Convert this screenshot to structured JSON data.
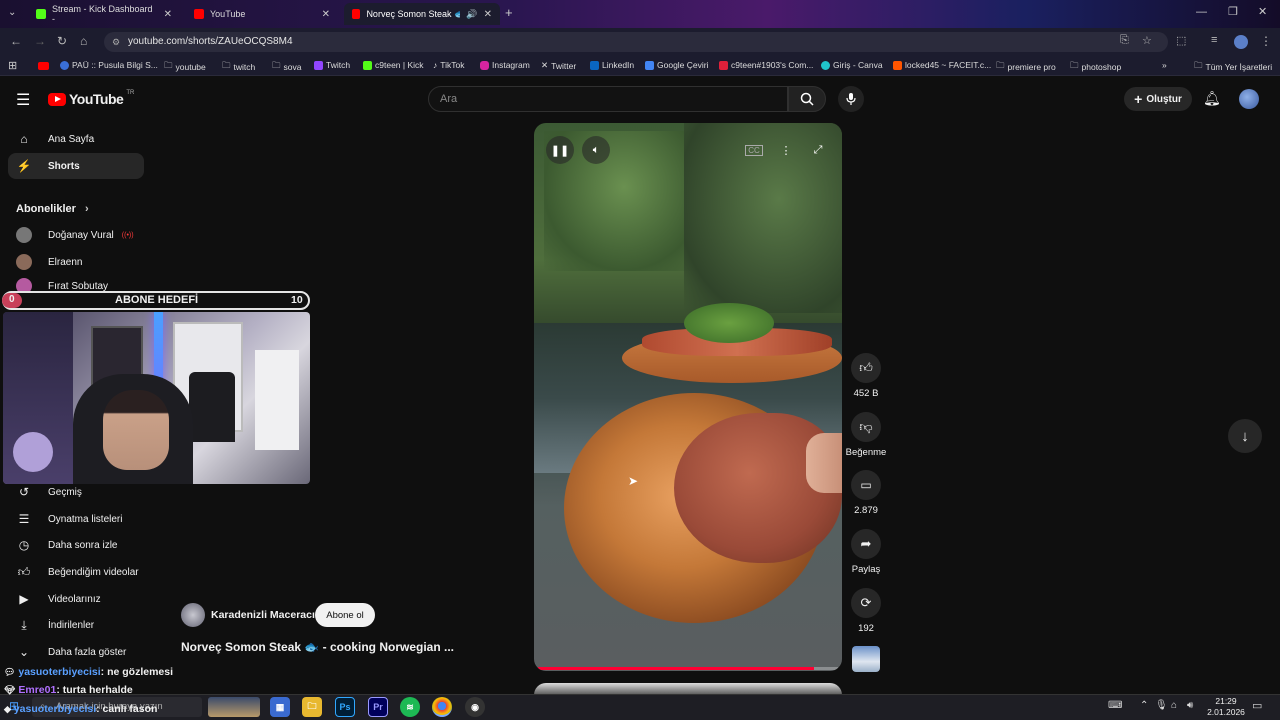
{
  "browser": {
    "tabs": [
      {
        "title": "Stream - Kick Dashboard -",
        "favicon_color": "#53fc18"
      },
      {
        "title": "YouTube",
        "favicon_color": "#ff0000"
      },
      {
        "title": "Norveç Somon Steak 🐟 - c",
        "favicon_color": "#ff0000"
      }
    ],
    "url": "youtube.com/shorts/ZAUeOCQS8M4",
    "bookmarks": [
      "PAÜ :: Pusula Bilgi S...",
      "youtube",
      "twitch",
      "sova",
      "Twitch",
      "c9teen | Kick",
      "TikTok",
      "Instagram",
      "Twitter",
      "LinkedIn",
      "Google Çeviri",
      "c9teen#1903's Com...",
      "Giriş - Canva",
      "locked45 ~ FACEIT.c...",
      "premiere pro",
      "photoshop"
    ],
    "bookmarks_more": "»",
    "all_bookmarks": "Tüm Yer İşaretleri"
  },
  "youtube": {
    "logo_text": "YouTube",
    "logo_region": "TR",
    "search_placeholder": "Ara",
    "create_label": "Oluştur",
    "sidebar": {
      "home": "Ana Sayfa",
      "shorts": "Shorts",
      "subscriptions_header": "Abonelikler",
      "subscriptions": [
        "Doğanay Vural",
        "Elraenn",
        "Fırat Sobutay"
      ],
      "library": [
        "Geçmiş",
        "Oynatma listeleri",
        "Daha sonra izle",
        "Beğendiğim videolar",
        "Videolarınız",
        "İndirilenler",
        "Daha fazla göster"
      ]
    },
    "short": {
      "channel": "Karadenizli Maceracı",
      "subscribe_label": "Abone ol",
      "title": "Norveç Somon Steak 🐟 - cooking Norwegian ...",
      "progress": 0.92,
      "actions": {
        "likes": "452 B",
        "dislike_label": "Beğenme",
        "comments": "2.879",
        "share_label": "Paylaş",
        "remix_count": "192"
      }
    }
  },
  "overlay": {
    "goal_label": "ABONE HEDEFİ",
    "goal_current": "0",
    "goal_target": "10",
    "chat": [
      {
        "user": "yasuoterbiyecisi",
        "message": ": ne gözlemesi",
        "color": "#5aa0ff"
      },
      {
        "user": "Emre01",
        "message": ": turta herhalde",
        "color": "#b070ff"
      },
      {
        "user": "yasuoterbiyecisi",
        "message": ": canlı fason",
        "color": "#5aa0ff"
      }
    ]
  },
  "taskbar": {
    "search_placeholder": "Aramak için buraya yazın",
    "time": "21:29",
    "date": "2.01.2026"
  }
}
